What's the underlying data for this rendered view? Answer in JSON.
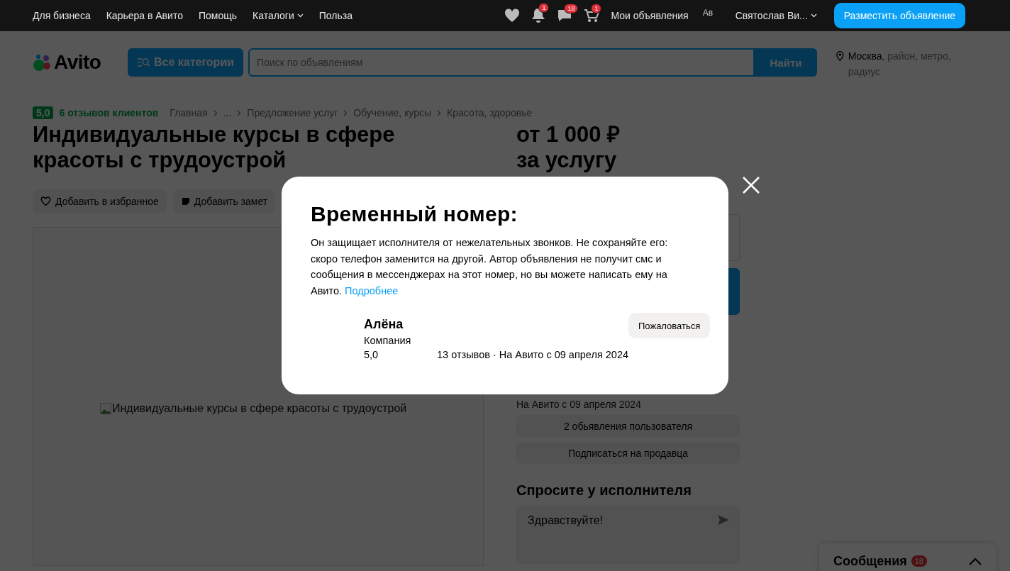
{
  "top_bar": {
    "links": [
      {
        "label": "Для бизнеса",
        "has_menu": false
      },
      {
        "label": "Карьера в Авито",
        "has_menu": false
      },
      {
        "label": "Помощь",
        "has_menu": false
      },
      {
        "label": "Каталоги",
        "has_menu": true
      },
      {
        "label": "Польза",
        "has_menu": false
      }
    ],
    "icons": [
      {
        "kind": "favorites"
      },
      {
        "kind": "notifications",
        "badge": "1"
      },
      {
        "kind": "messages",
        "badge": "18"
      },
      {
        "kind": "cart",
        "badge": "1"
      }
    ],
    "my_ads": "Мои объявления",
    "avatar_alt": "Ав",
    "user": "Святослав Ви...",
    "post_button": "Разместить объявление"
  },
  "header": {
    "logo": "Avito",
    "categories_button": "Все категории",
    "search": {
      "placeholder": "Поиск по объявлениям"
    },
    "search_button": "Найти",
    "location": {
      "city": "Москва",
      "hint": ", район, метро, радиус"
    }
  },
  "listing": {
    "rating": "5,0",
    "reviews_link": "6 отзывов клиентов",
    "breadcrumbs": [
      "Главная",
      "...",
      "Предложение услуг",
      "Обучение, курсы",
      "Красота, здоровье"
    ],
    "title": "Индивидуальные курсы в сфере красоты с трудоустрой",
    "price": "от 1 000 ₽",
    "price_unit": "за услугу",
    "actions": [
      {
        "kind": "favorite",
        "label": "Добавить в избранное"
      },
      {
        "kind": "note",
        "label": "Добавить замет"
      }
    ],
    "image_alt": "Индивидуальные курсы в сфере красоты с трудоустрой"
  },
  "seller_panel": {
    "since": "На Авито с 09 апреля 2024",
    "buttons": [
      "2 обьявления пользователя",
      "Подписаться на продавца"
    ],
    "ask_heading": "Спросите у исполнителя",
    "message": {
      "value": "Здравствуйте!"
    }
  },
  "messages_widget": {
    "title": "Сообщения",
    "badge": "18",
    "expanded": false
  },
  "modal": {
    "title": "Временный номер:",
    "text": "Он защищает исполнителя от нежелательных звонков. Не сохраняйте его: скоро телефон заменится на другой. Автор объявления не получит смс и сообщения в мессенджерах на этот номер, но вы можете написать ему на Авито.",
    "link": "Подробнее",
    "seller": {
      "name": "Алёна",
      "type": "Компания",
      "rating": "5,0",
      "details": "13 отзывов · На Авито с 09 апреля 2024"
    },
    "report_button": "Пожаловаться"
  }
}
